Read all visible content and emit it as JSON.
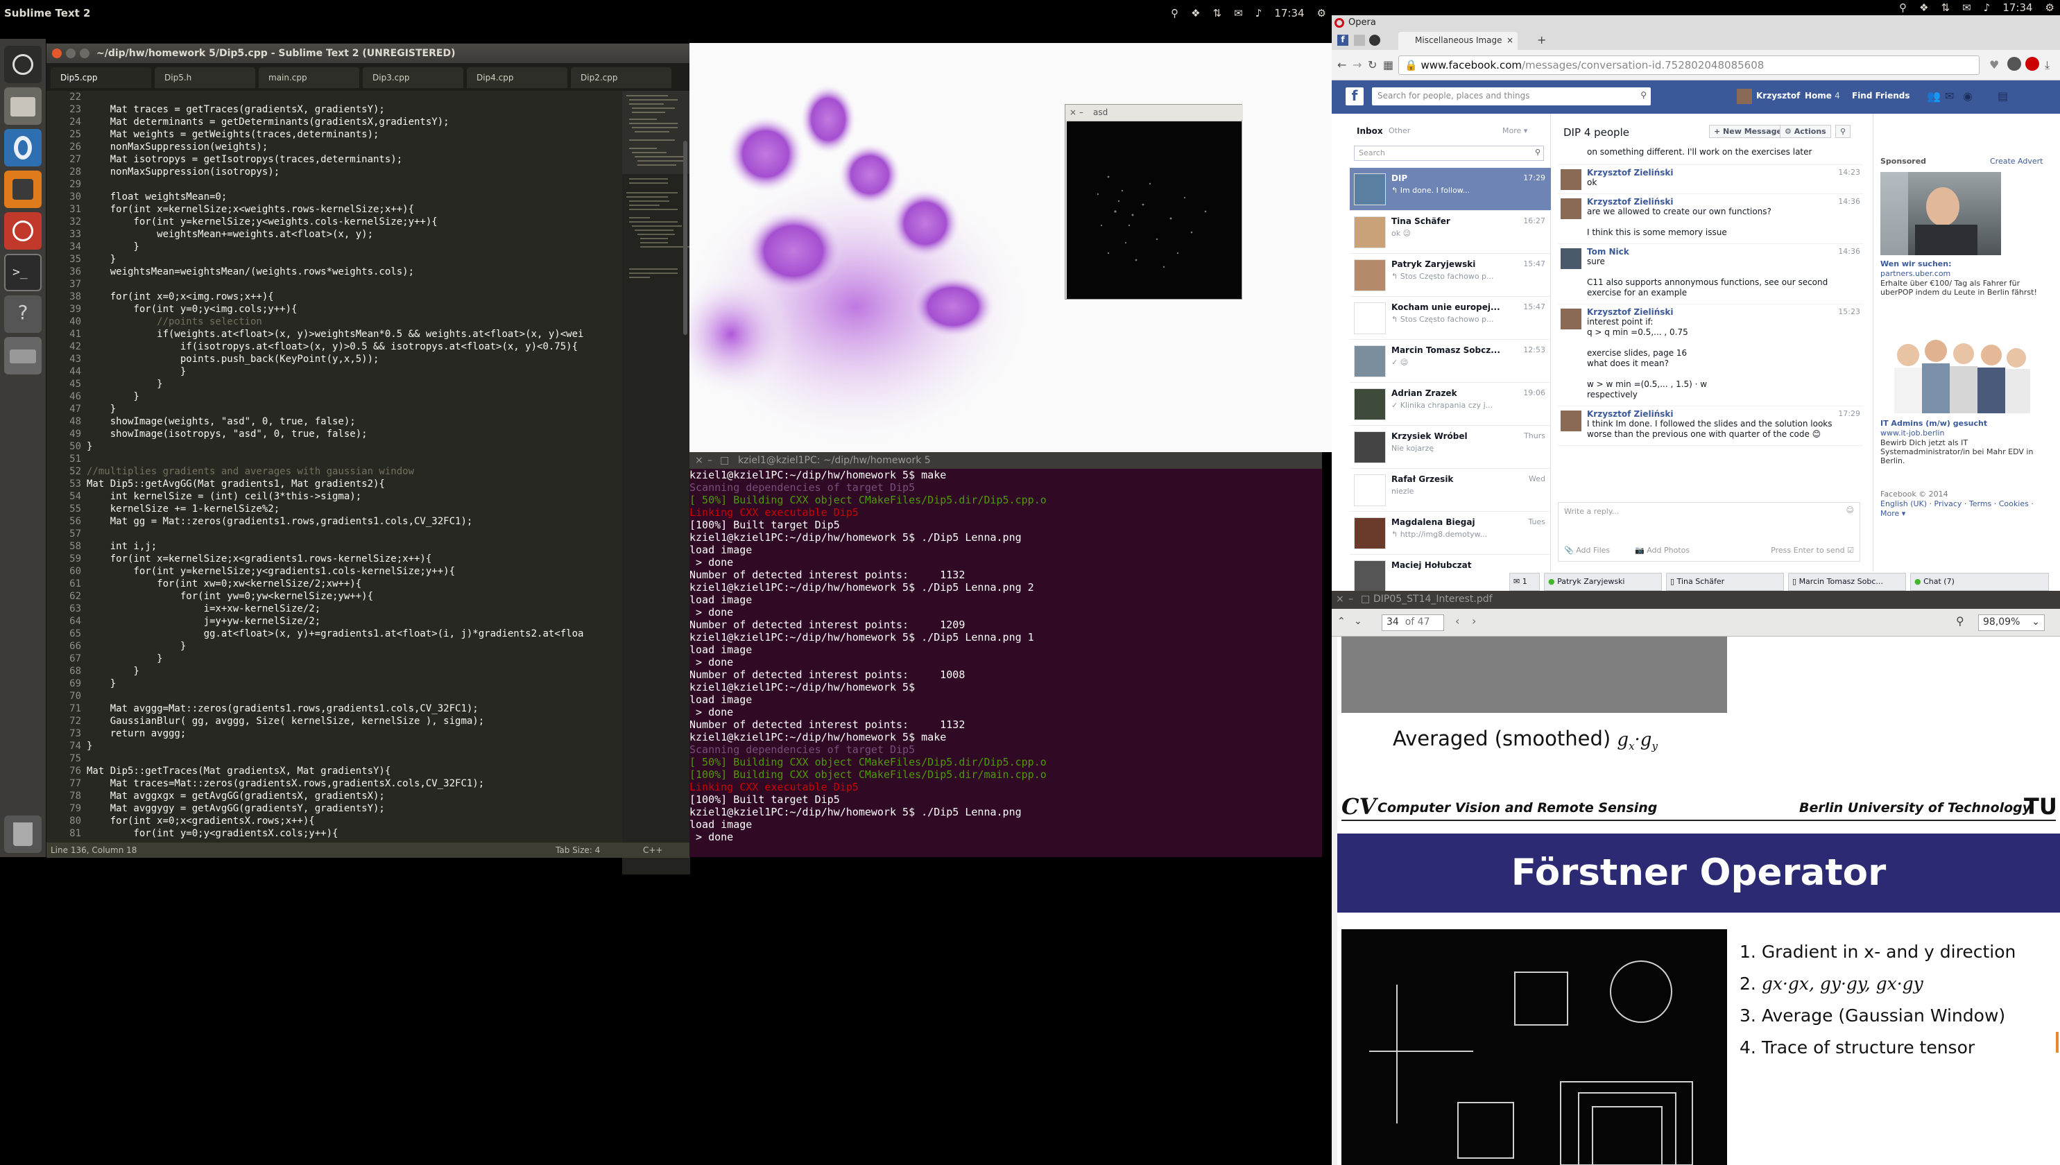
{
  "topbar": {
    "app_name": "Sublime Text 2",
    "clock_left": "17:34",
    "clock_right": "17:34"
  },
  "launcher": {
    "items": [
      "dash-home",
      "files",
      "opera",
      "sublime",
      "lightning",
      "terminal",
      "help",
      "drive",
      "trash"
    ]
  },
  "sublime": {
    "title": "~/dip/hw/homework 5/Dip5.cpp - Sublime Text 2 (UNREGISTERED)",
    "tabs": [
      "Dip5.cpp",
      "Dip5.h",
      "main.cpp",
      "Dip3.cpp",
      "Dip4.cpp",
      "Dip2.cpp"
    ],
    "status_left": "Line 136, Column 18",
    "status_tab": "Tab Size: 4",
    "status_lang": "C++",
    "code": [
      [
        "22",
        ""
      ],
      [
        "23",
        "    Mat traces = getTraces(gradientsX, gradientsY);"
      ],
      [
        "24",
        "    Mat determinants = getDeterminants(gradientsX,gradientsY);"
      ],
      [
        "25",
        "    Mat weights = getWeights(traces,determinants);"
      ],
      [
        "26",
        "    nonMaxSuppression(weights);"
      ],
      [
        "27",
        "    Mat isotropys = getIsotropys(traces,determinants);"
      ],
      [
        "28",
        "    nonMaxSuppression(isotropys);"
      ],
      [
        "29",
        ""
      ],
      [
        "30",
        "    float weightsMean=0;"
      ],
      [
        "31",
        "    for(int x=kernelSize;x<weights.rows-kernelSize;x++){"
      ],
      [
        "32",
        "        for(int y=kernelSize;y<weights.cols-kernelSize;y++){"
      ],
      [
        "33",
        "            weightsMean+=weights.at<float>(x, y);"
      ],
      [
        "34",
        "        }"
      ],
      [
        "35",
        "    }"
      ],
      [
        "36",
        "    weightsMean=weightsMean/(weights.rows*weights.cols);"
      ],
      [
        "37",
        ""
      ],
      [
        "38",
        "    for(int x=0;x<img.rows;x++){"
      ],
      [
        "39",
        "        for(int y=0;y<img.cols;y++){"
      ],
      [
        "40",
        "            //points selection"
      ],
      [
        "41",
        "            if(weights.at<float>(x, y)>weightsMean*0.5 && weights.at<float>(x, y)<wei"
      ],
      [
        "42",
        "                if(isotropys.at<float>(x, y)>0.5 && isotropys.at<float>(x, y)<0.75){"
      ],
      [
        "43",
        "                points.push_back(KeyPoint(y,x,5));"
      ],
      [
        "44",
        "                }"
      ],
      [
        "45",
        "            }"
      ],
      [
        "46",
        "        }"
      ],
      [
        "47",
        "    }"
      ],
      [
        "48",
        "    showImage(weights, \"asd\", 0, true, false);"
      ],
      [
        "49",
        "    showImage(isotropys, \"asd\", 0, true, false);"
      ],
      [
        "50",
        "}"
      ],
      [
        "51",
        ""
      ],
      [
        "52",
        "//multiplies gradients and averages with gaussian window"
      ],
      [
        "53",
        "Mat Dip5::getAvgGG(Mat gradients1, Mat gradients2){"
      ],
      [
        "54",
        "    int kernelSize = (int) ceil(3*this->sigma);"
      ],
      [
        "55",
        "    kernelSize += 1-kernelSize%2;"
      ],
      [
        "56",
        "    Mat gg = Mat::zeros(gradients1.rows,gradients1.cols,CV_32FC1);"
      ],
      [
        "57",
        ""
      ],
      [
        "58",
        "    int i,j;"
      ],
      [
        "59",
        "    for(int x=kernelSize;x<gradients1.rows-kernelSize;x++){"
      ],
      [
        "60",
        "        for(int y=kernelSize;y<gradients1.cols-kernelSize;y++){"
      ],
      [
        "61",
        "            for(int xw=0;xw<kernelSize/2;xw++){"
      ],
      [
        "62",
        "                for(int yw=0;yw<kernelSize;yw++){"
      ],
      [
        "63",
        "                    i=x+xw-kernelSize/2;"
      ],
      [
        "64",
        "                    j=y+yw-kernelSize/2;"
      ],
      [
        "65",
        "                    gg.at<float>(x, y)+=gradients1.at<float>(i, j)*gradients2.at<floa"
      ],
      [
        "66",
        "                }"
      ],
      [
        "67",
        "            }"
      ],
      [
        "68",
        "        }"
      ],
      [
        "69",
        "    }"
      ],
      [
        "70",
        ""
      ],
      [
        "71",
        "    Mat avggg=Mat::zeros(gradients1.rows,gradients1.cols,CV_32FC1);"
      ],
      [
        "72",
        "    GaussianBlur( gg, avggg, Size( kernelSize, kernelSize ), sigma);"
      ],
      [
        "73",
        "    return avggg;"
      ],
      [
        "74",
        "}"
      ],
      [
        "75",
        ""
      ],
      [
        "76",
        "Mat Dip5::getTraces(Mat gradientsX, Mat gradientsY){"
      ],
      [
        "77",
        "    Mat traces=Mat::zeros(gradientsX.rows,gradientsX.cols,CV_32FC1);"
      ],
      [
        "78",
        "    Mat avggxgx = getAvgGG(gradientsX, gradientsX);"
      ],
      [
        "79",
        "    Mat avggygy = getAvgGG(gradientsY, gradientsY);"
      ],
      [
        "80",
        "    for(int x=0;x<gradientsX.rows;x++){"
      ],
      [
        "81",
        "        for(int y=0;y<gradientsX.cols;y++){"
      ]
    ]
  },
  "asd_window": {
    "title": "asd"
  },
  "terminal": {
    "title": "kziel1@kziel1PC: ~/dip/hw/homework 5",
    "lines": [
      [
        "w",
        "kziel1@kziel1PC:~/dip/hw/homework 5$ make"
      ],
      [
        "m",
        "Scanning dependencies of target Dip5"
      ],
      [
        "g",
        "[ 50%] Building CXX object CMakeFiles/Dip5.dir/Dip5.cpp.o"
      ],
      [
        "r",
        "Linking CXX executable Dip5"
      ],
      [
        "w",
        "[100%] Built target Dip5"
      ],
      [
        "w",
        "kziel1@kziel1PC:~/dip/hw/homework 5$ ./Dip5 Lenna.png"
      ],
      [
        "w",
        "load image"
      ],
      [
        "w",
        " > done"
      ],
      [
        "w",
        "Number of detected interest points:     1132"
      ],
      [
        "w",
        "kziel1@kziel1PC:~/dip/hw/homework 5$ ./Dip5 Lenna.png 2"
      ],
      [
        "w",
        "load image"
      ],
      [
        "w",
        " > done"
      ],
      [
        "w",
        "Number of detected interest points:     1209"
      ],
      [
        "w",
        "kziel1@kziel1PC:~/dip/hw/homework 5$ ./Dip5 Lenna.png 1"
      ],
      [
        "w",
        "load image"
      ],
      [
        "w",
        " > done"
      ],
      [
        "w",
        "Number of detected interest points:     1008"
      ],
      [
        "w",
        "kziel1@kziel1PC:~/dip/hw/homework 5$"
      ],
      [
        "w",
        "load image"
      ],
      [
        "w",
        " > done"
      ],
      [
        "w",
        "Number of detected interest points:     1132"
      ],
      [
        "w",
        "kziel1@kziel1PC:~/dip/hw/homework 5$ make"
      ],
      [
        "m",
        "Scanning dependencies of target Dip5"
      ],
      [
        "g",
        "[ 50%] Building CXX object CMakeFiles/Dip5.dir/Dip5.cpp.o"
      ],
      [
        "g",
        "[100%] Building CXX object CMakeFiles/Dip5.dir/main.cpp.o"
      ],
      [
        "r",
        "Linking CXX executable Dip5"
      ],
      [
        "w",
        "[100%] Built target Dip5"
      ],
      [
        "w",
        "kziel1@kziel1PC:~/dip/hw/homework 5$ ./Dip5 Lenna.png"
      ],
      [
        "w",
        "load image"
      ],
      [
        "w",
        " > done"
      ]
    ]
  },
  "opera": {
    "app_title": "Opera",
    "tab_label": "Miscellaneous Image",
    "url_prefix": "www.facebook.com",
    "url_rest": "/messages/conversation-id.752802048085608",
    "fb": {
      "search_placeholder": "Search for people, places and things",
      "user": "Krzysztof",
      "home": "Home",
      "home_count": "4",
      "find_friends": "Find Friends",
      "inbox": "Inbox",
      "other": "Other",
      "more": "More",
      "search_msgs": "Search",
      "conversation_title": "DIP",
      "people_count": "4 people",
      "new_message": "+ New Message",
      "actions": "Actions",
      "threads": [
        {
          "name": "DIP",
          "preview": "↰ Im done. I follow...",
          "time": "17:29"
        },
        {
          "name": "Tina Schäfer",
          "preview": "ok 😉",
          "time": "16:27"
        },
        {
          "name": "Patryk Zaryjewski",
          "preview": "↰ Stos Często fachowo p...",
          "time": "15:47"
        },
        {
          "name": "Kocham unie europej...",
          "preview": "↰ Stos Często fachowo p...",
          "time": "15:47"
        },
        {
          "name": "Marcin Tomasz Sobcz...",
          "preview": "✓ 😉",
          "time": "12:53"
        },
        {
          "name": "Adrian Zrazek",
          "preview": "✓ Klinika chrapania czy j...",
          "time": "19:06"
        },
        {
          "name": "Krzysiek Wróbel",
          "preview": "Nie kojarzę",
          "time": "Thurs"
        },
        {
          "name": "Rafał Grzesik",
          "preview": "niezle",
          "time": "Wed"
        },
        {
          "name": "Magdalena Biegaj",
          "preview": "↰ http://img8.demotyw...",
          "time": "Tues"
        },
        {
          "name": "Maciej Hołubczat",
          "preview": "",
          "time": ""
        }
      ],
      "messages": [
        {
          "name": "",
          "lines": [
            "on something different. I'll work on the exercises later"
          ],
          "time": ""
        },
        {
          "name": "Krzysztof Zieliński",
          "lines": [
            "ok"
          ],
          "time": "14:23"
        },
        {
          "name": "Krzysztof Zieliński",
          "lines": [
            "are we allowed to create our own functions?",
            "",
            "I think this is some memory issue"
          ],
          "time": "14:36"
        },
        {
          "name": "Tom Nick",
          "lines": [
            "sure",
            "",
            "C11 also supports annonymous functions, see our second",
            "exercise for an example"
          ],
          "time": "14:36"
        },
        {
          "name": "Krzysztof Zieliński",
          "lines": [
            "interest point if:",
            "q > q min =0.5,... , 0.75",
            "",
            "exercise slides, page 16",
            "what does it mean?",
            "",
            "w > w min =(0.5,... , 1.5) · w",
            "respectively"
          ],
          "time": "15:23"
        },
        {
          "name": "Krzysztof Zieliński",
          "lines": [
            "I think Im done. I followed the slides and the solution looks",
            "worse than the previous one with quarter of the code 😊"
          ],
          "time": "17:29"
        }
      ],
      "reply_placeholder": "Write a reply...",
      "add_files": "Add Files",
      "add_photos": "Add Photos",
      "press_enter": "Press Enter to send",
      "sponsored": "Sponsored",
      "create_advert": "Create Advert",
      "ad1_title": "Wen wir suchen:",
      "ad1_site": "partners.uber.com",
      "ad1_text": "Erhalte über €100/ Tag als Fahrer für uberPOP indem du Leute in Berlin fährst!",
      "ad2_title": "IT Admins (m/w) gesucht",
      "ad2_site": "www.it-job.berlin",
      "ad2_text": "Bewirb Dich jetzt als IT Systemadministrator/in bei Mahr EDV in Berlin.",
      "footer1": "Facebook © 2014",
      "footer2": "English (UK) · Privacy · Terms · Cookies ·",
      "footer3": "More ▾",
      "chat_tabs": [
        "1",
        "Patryk Zaryjewski",
        "Tina Schäfer",
        "Marcin Tomasz Sobc...",
        "Chat (7)"
      ]
    }
  },
  "pdf": {
    "title": "DIP05_ST14_Interest.pdf",
    "page": "34",
    "of_pages": "of 47",
    "zoom": "98,09%",
    "caption": "Averaged (smoothed)",
    "caption_math": "g_x · g_y",
    "header_left": "Computer Vision and Remote Sensing",
    "header_right": "Berlin University of Technology",
    "slide_title": "Förstner Operator",
    "list": [
      "Gradient in x- and y direction",
      "gx·gx, gy·gy, gx·gy",
      "Average (Gaussian Window)",
      "Trace of structure tensor"
    ]
  },
  "colors": {
    "fb_blue": "#3b5998",
    "sublime_bg": "#272822",
    "terminal_bg": "#300a24",
    "slide_purple": "#2b2a72"
  }
}
